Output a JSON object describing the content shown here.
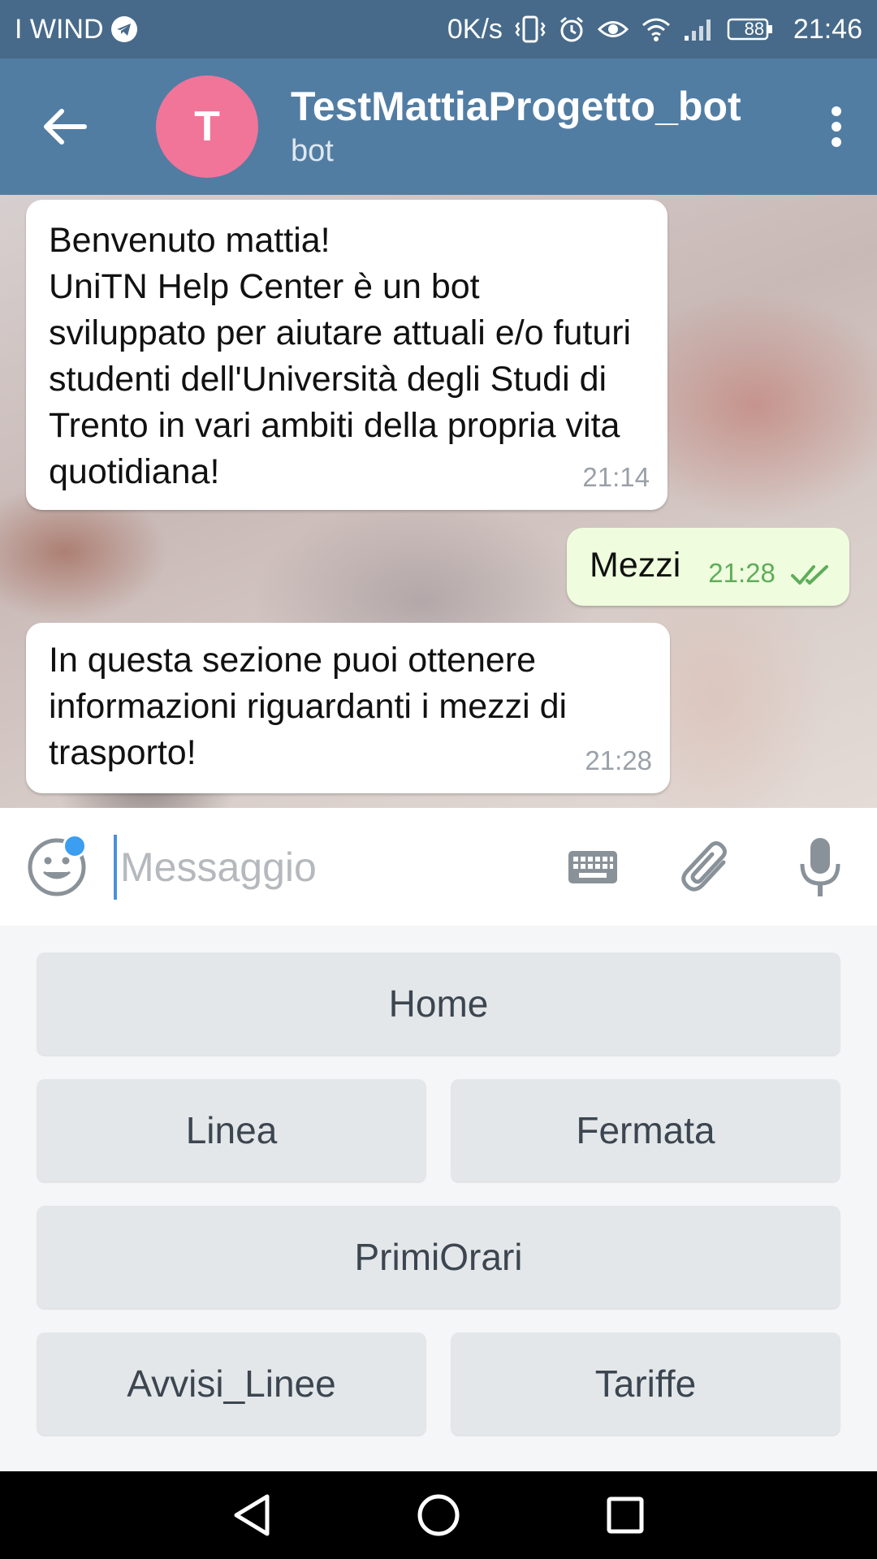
{
  "status_bar": {
    "carrier": "I WIND",
    "net_speed": "0K/s",
    "battery": "88",
    "clock": "21:46",
    "icons": [
      "telegram-icon",
      "vibrate-icon",
      "alarm-icon",
      "eye-icon",
      "wifi-icon",
      "signal-icon",
      "battery-icon"
    ]
  },
  "header": {
    "avatar_letter": "T",
    "title": "TestMattiaProgetto_bot",
    "subtitle": "bot",
    "colors": {
      "header": "#527da3",
      "avatar": "#f07599"
    }
  },
  "messages": [
    {
      "from": "bot",
      "text": "Benvenuto mattia!\nUniTN Help Center è un bot sviluppato per aiutare attuali e/o futuri studenti dell'Università degli Studi di Trento in vari ambiti della propria vita quotidiana!",
      "time": "21:14"
    },
    {
      "from": "user",
      "text": "Mezzi",
      "time": "21:28",
      "read": true
    },
    {
      "from": "bot",
      "text": "In questa sezione puoi ottenere informazioni riguardanti i mezzi di trasporto!",
      "time": "21:28"
    }
  ],
  "composer": {
    "placeholder": "Messaggio",
    "value": ""
  },
  "keyboard": {
    "rows": [
      [
        "Home"
      ],
      [
        "Linea",
        "Fermata"
      ],
      [
        "PrimiOrari"
      ],
      [
        "Avvisi_Linee",
        "Tariffe"
      ]
    ]
  }
}
